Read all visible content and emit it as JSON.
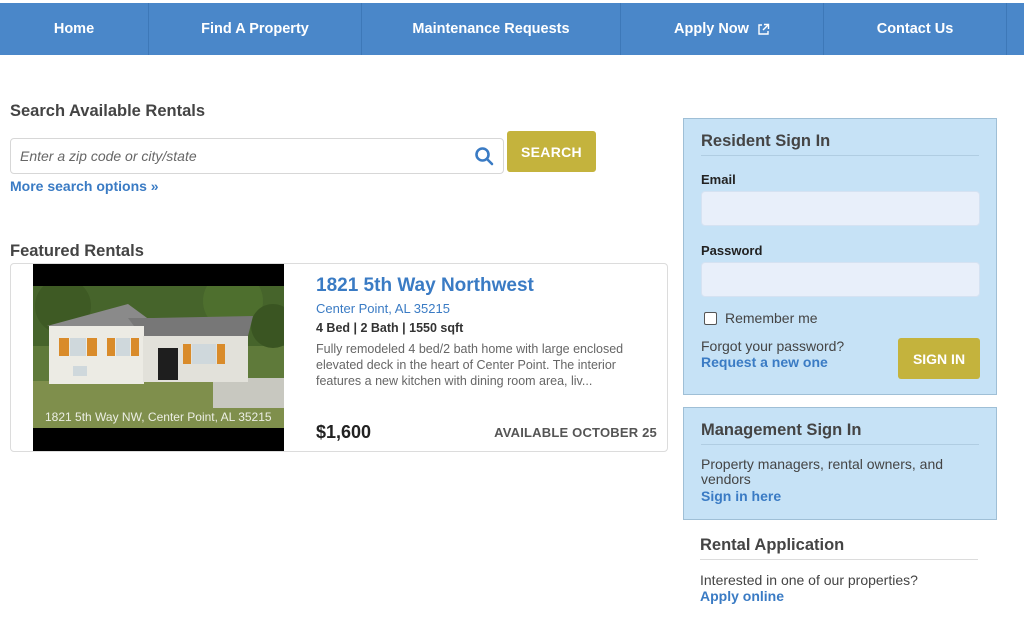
{
  "nav": {
    "items": [
      {
        "label": "Home"
      },
      {
        "label": "Find A Property"
      },
      {
        "label": "Maintenance Requests"
      },
      {
        "label": "Apply Now",
        "icon": "external-link-icon"
      },
      {
        "label": "Contact Us"
      }
    ]
  },
  "search": {
    "title": "Search Available Rentals",
    "placeholder": "Enter a zip code or city/state",
    "button_label": "SEARCH",
    "more_options": "More search options »"
  },
  "featured": {
    "title": "Featured Rentals",
    "listing": {
      "name": "1821 5th Way Northwest",
      "address": "Center Point, AL 35215",
      "specs": "4 Bed | 2 Bath | 1550 sqft",
      "description": "Fully remodeled 4 bed/2 bath home with large enclosed elevated deck in the heart of Center Point. The interior features a new kitchen with dining room area, liv...",
      "price": "$1,600",
      "availability": "AVAILABLE OCTOBER 25",
      "photo_caption": "1821 5th Way NW, Center Point, AL 35215"
    }
  },
  "resident": {
    "title": "Resident Sign In",
    "email_label": "Email",
    "password_label": "Password",
    "remember_label": "Remember me",
    "forgot_text": "Forgot your password?",
    "forgot_link": "Request a new one",
    "signin_label": "SIGN IN"
  },
  "management": {
    "title": "Management Sign In",
    "text": "Property managers, rental owners, and vendors",
    "link": "Sign in here"
  },
  "application": {
    "title": "Rental Application",
    "text": "Interested in one of our properties?",
    "link": "Apply online"
  },
  "colors": {
    "nav_bg": "#4a87c9",
    "accent_button": "#c4b33d",
    "link": "#3a7bc4",
    "panel_bg": "#c6e2f6"
  }
}
